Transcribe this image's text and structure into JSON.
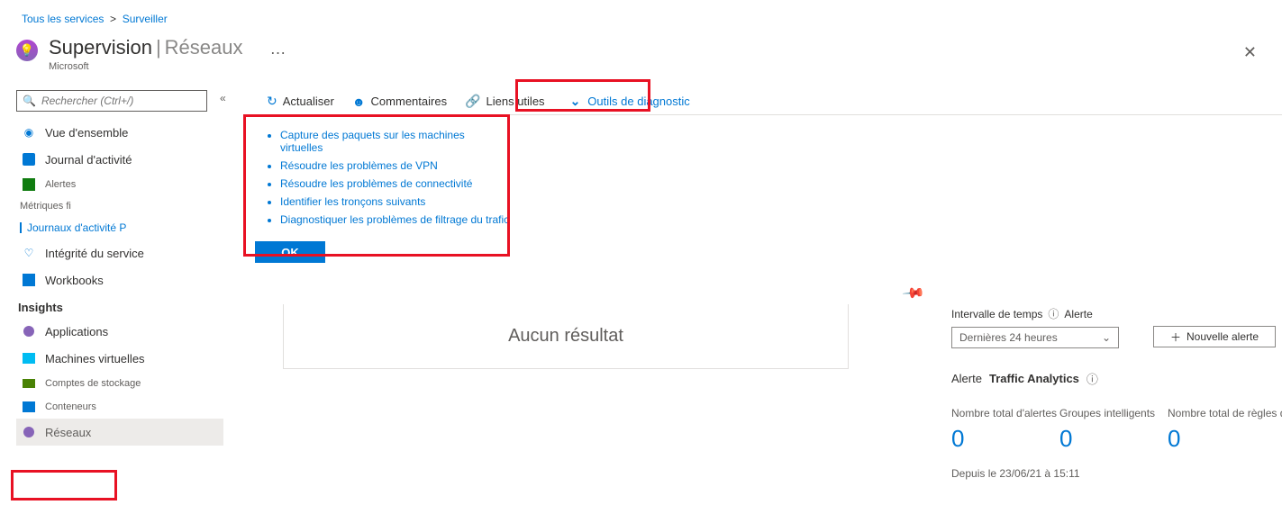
{
  "breadcrumb": {
    "all_services": "Tous les services",
    "monitor": "Surveiller"
  },
  "header": {
    "title": "Supervision",
    "sep": "|",
    "section": "Réseaux",
    "dots": "…",
    "subtitle": "Microsoft"
  },
  "search": {
    "placeholder": "Rechercher (Ctrl+/)"
  },
  "sidebar": {
    "overview": "Vue d'ensemble",
    "activity": "Journal d'activité",
    "alerts_sm": "Alertes",
    "metrics_sm": "Métriques fi",
    "actlog_link": "Journaux d'activité P",
    "servicehealth": "Intégrité du service",
    "workbooks": "Workbooks",
    "section_insights": "Insights",
    "applications": "Applications",
    "vms": "Machines virtuelles",
    "storage": "Comptes de stockage",
    "containers": "Conteneurs",
    "networks": "Réseaux"
  },
  "toolbar": {
    "refresh": "Actualiser",
    "comments": "Commentaires",
    "useful_links": "Liens utiles",
    "diag_tools": "Outils de diagnostic"
  },
  "diag": {
    "items": [
      "Capture des paquets sur les machines virtuelles",
      "Résoudre les problèmes de VPN",
      "Résoudre les problèmes de connectivité",
      "Identifier les tronçons suivants",
      "Diagnostiquer les problèmes de filtrage du trafic"
    ],
    "ok": "OK"
  },
  "main": {
    "no_result": "Aucun résultat"
  },
  "right": {
    "interval_label": "Intervalle de temps",
    "alert_label": "Alerte",
    "time_selected": "Dernières 24 heures",
    "new_alert": "Nouvelle alerte",
    "alert_word": "Alerte",
    "traffic": "Traffic Analytics",
    "m1_label": "Nombre total d'alertes",
    "m2_label": "Groupes intelligents",
    "m3_label": "Nombre total de règles d",
    "m1_val": "0",
    "m2_val": "0",
    "m3_val": "0",
    "since": "Depuis le 23/06/21 à 15:11"
  }
}
